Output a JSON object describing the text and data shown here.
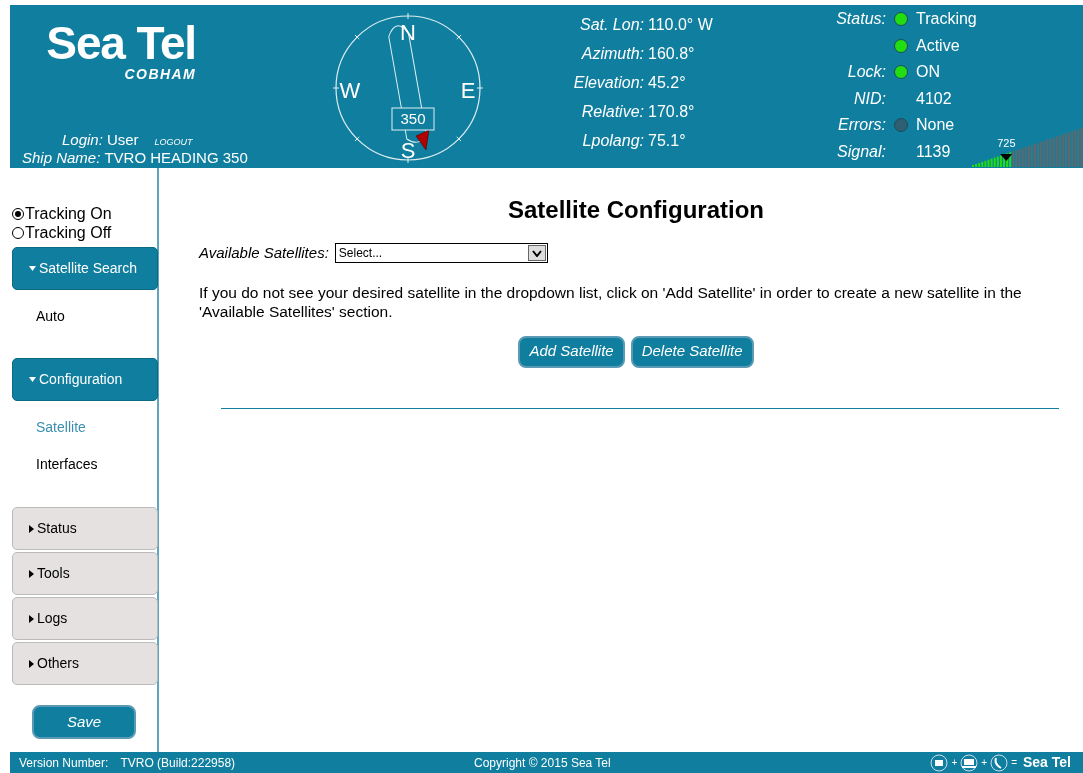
{
  "header": {
    "logo": "Sea Tel",
    "logo_sub": "COBHAM",
    "login_label": "Login:",
    "login_user": "User",
    "logout": "LOGOUT",
    "ship_label": "Ship Name:",
    "ship_name": "TVRO HEADING 350",
    "compass": {
      "n": "N",
      "e": "E",
      "s": "S",
      "w": "W",
      "heading": "350"
    },
    "readouts": [
      {
        "label": "Sat. Lon:",
        "value": "110.0° W"
      },
      {
        "label": "Azimuth:",
        "value": "160.8°"
      },
      {
        "label": "Elevation:",
        "value": "45.2°"
      },
      {
        "label": "Relative:",
        "value": "170.8°"
      },
      {
        "label": "Lpolang:",
        "value": "75.1°"
      }
    ],
    "status": [
      {
        "label": "Status:",
        "color": "#22dd11",
        "value": "Tracking"
      },
      {
        "color": "#22dd11",
        "value": "Active"
      },
      {
        "label": "Lock:",
        "color": "#22dd11",
        "value": "ON"
      },
      {
        "label": "NID:",
        "value": "4102"
      },
      {
        "label": "Errors:",
        "color": "#2f5f73",
        "value": "None"
      },
      {
        "label": "Signal:",
        "value": "1139"
      }
    ],
    "signal_meter": {
      "marker": "725"
    }
  },
  "sidebar": {
    "tracking": [
      {
        "label": "Tracking On",
        "selected": true
      },
      {
        "label": "Tracking Off",
        "selected": false
      }
    ],
    "sections": [
      {
        "label": "Satellite Search",
        "expanded": true,
        "children": [
          {
            "label": "Auto",
            "selected": false
          }
        ]
      },
      {
        "label": "Configuration",
        "expanded": true,
        "children": [
          {
            "label": "Satellite",
            "selected": true
          },
          {
            "label": "Interfaces",
            "selected": false
          }
        ]
      },
      {
        "label": "Status",
        "expanded": false
      },
      {
        "label": "Tools",
        "expanded": false
      },
      {
        "label": "Logs",
        "expanded": false
      },
      {
        "label": "Others",
        "expanded": false
      }
    ],
    "save": "Save"
  },
  "main": {
    "title": "Satellite Configuration",
    "field_label": "Available Satellites:",
    "select_value": "Select...",
    "help": "If you do not see your desired satellite in the dropdown list, click on 'Add Satellite' in order to create a new satellite in the 'Available Satellites' section.",
    "buttons": [
      "Add Satellite",
      "Delete Satellite"
    ]
  },
  "footer": {
    "version_label": "Version Number:",
    "version": "TVRO (Build:222958)",
    "copyright": "Copyright © 2015 Sea Tel",
    "joiners": [
      "+",
      "+",
      "="
    ],
    "logo": "Sea Tel"
  }
}
